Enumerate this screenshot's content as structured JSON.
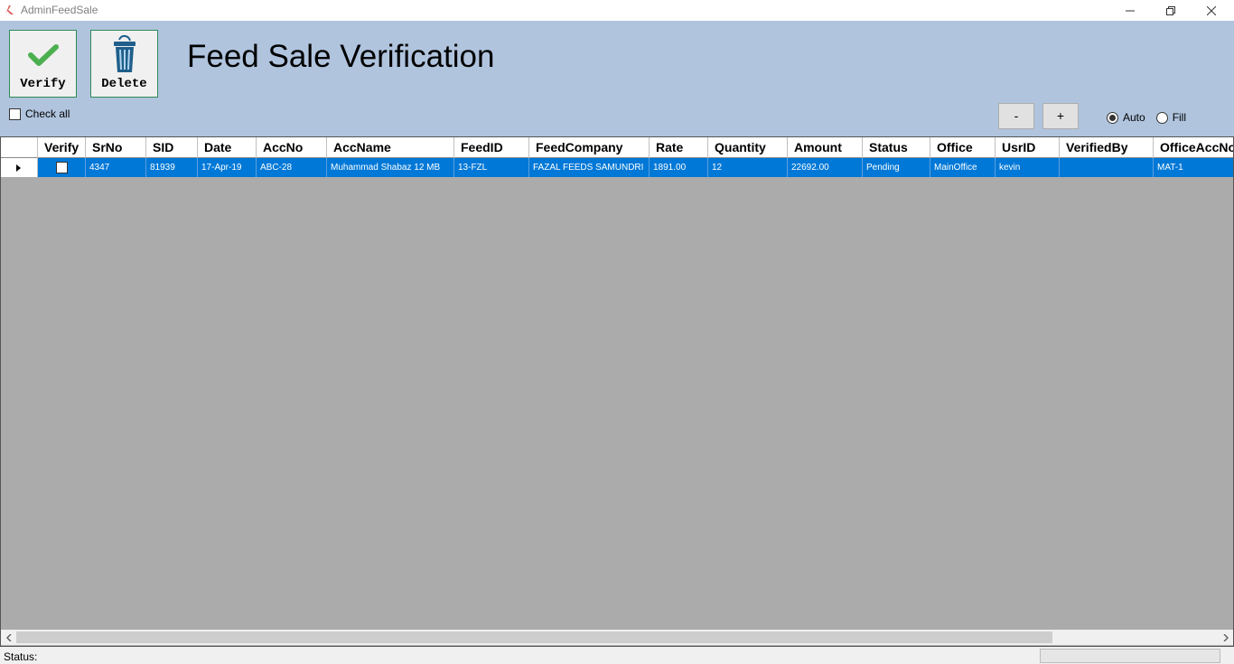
{
  "window": {
    "title": "AdminFeedSale"
  },
  "toolbar": {
    "verify_label": "Verify",
    "delete_label": "Delete",
    "page_title": "Feed Sale Verification",
    "check_all_label": "Check all",
    "check_all_checked": false,
    "zoom_out_label": "-",
    "zoom_in_label": "+",
    "size_mode": {
      "options": [
        "Auto",
        "Fill"
      ],
      "selected": "Auto"
    }
  },
  "grid": {
    "columns": [
      "Verify",
      "SrNo",
      "SID",
      "Date",
      "AccNo",
      "AccName",
      "FeedID",
      "FeedCompany",
      "Rate",
      "Quantity",
      "Amount",
      "Status",
      "Office",
      "UsrID",
      "VerifiedBy",
      "OfficeAccNo"
    ],
    "rows": [
      {
        "verify": false,
        "SrNo": "4347",
        "SID": "81939",
        "Date": "17-Apr-19",
        "AccNo": "ABC-28",
        "AccName": "Muhammad Shabaz 12 MB",
        "FeedID": "13-FZL",
        "FeedCompany": "FAZAL FEEDS SAMUNDRI",
        "Rate": "1891.00",
        "Quantity": "12",
        "Amount": "22692.00",
        "Status": "Pending",
        "Office": "MainOffice",
        "UsrID": "kevin",
        "VerifiedBy": "",
        "OfficeAccNo": "MAT-1",
        "selected": true
      }
    ]
  },
  "statusbar": {
    "label": "Status:"
  },
  "colors": {
    "header_bg": "#b0c4de",
    "grid_bg": "#ababab",
    "selection": "#0078d7",
    "verify_check": "#4caf50",
    "delete_icon": "#1f5f8b"
  }
}
